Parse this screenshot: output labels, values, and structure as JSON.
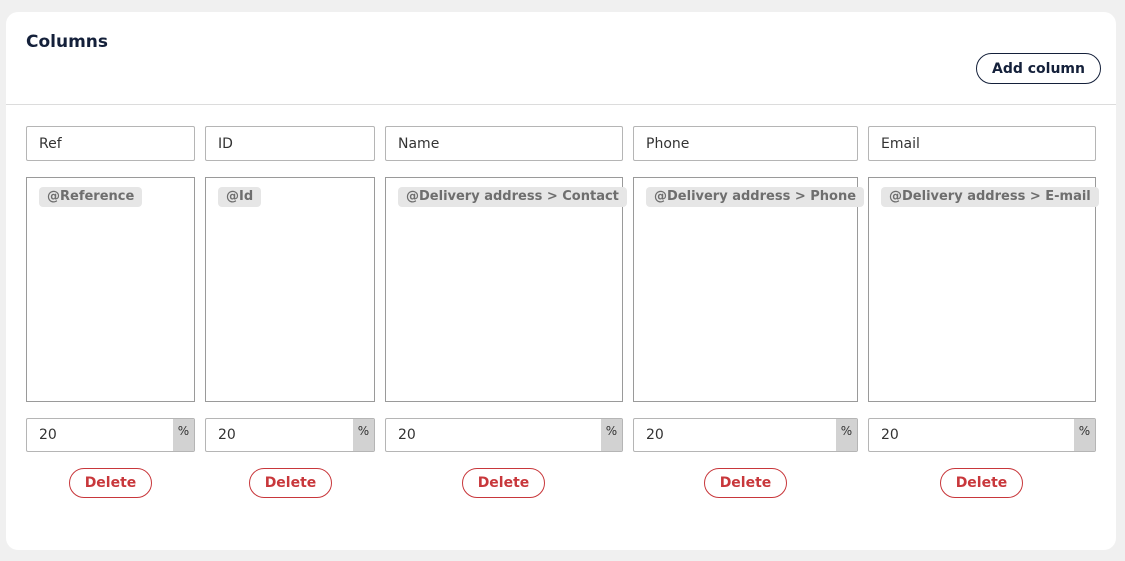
{
  "panel": {
    "title": "Columns",
    "add_button_label": "Add column"
  },
  "columns": [
    {
      "name": "Ref",
      "formula_token": "@Reference",
      "width": "20",
      "unit": "%",
      "delete_label": "Delete"
    },
    {
      "name": "ID",
      "formula_token": "@Id",
      "width": "20",
      "unit": "%",
      "delete_label": "Delete"
    },
    {
      "name": "Name",
      "formula_token": "@Delivery address > Contact",
      "width": "20",
      "unit": "%",
      "delete_label": "Delete"
    },
    {
      "name": "Phone",
      "formula_token": "@Delivery address > Phone",
      "width": "20",
      "unit": "%",
      "delete_label": "Delete"
    },
    {
      "name": "Email",
      "formula_token": "@Delivery address > E-mail",
      "width": "20",
      "unit": "%",
      "delete_label": "Delete"
    }
  ],
  "colors": {
    "title": "#14203a",
    "delete": "#c8373b",
    "token_bg": "#e6e6e6"
  }
}
